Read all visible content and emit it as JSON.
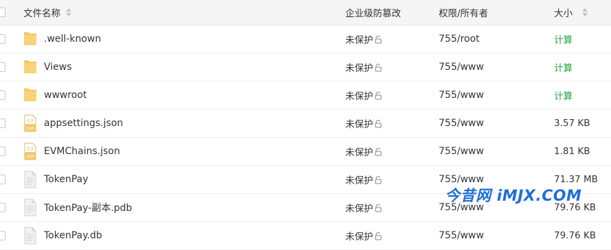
{
  "columns": {
    "name": "文件名称",
    "protection": "企业级防篡改",
    "permission": "权限/所有者",
    "size": "大小"
  },
  "rows": [
    {
      "name": ".well-known",
      "type": "folder",
      "protection": "未保护",
      "permission": "755/root",
      "size": "计算",
      "size_is_action": true
    },
    {
      "name": "Views",
      "type": "folder",
      "protection": "未保护",
      "permission": "755/www",
      "size": "计算",
      "size_is_action": true
    },
    {
      "name": "wwwroot",
      "type": "folder",
      "protection": "未保护",
      "permission": "755/www",
      "size": "计算",
      "size_is_action": true
    },
    {
      "name": "appsettings.json",
      "type": "json",
      "protection": "未保护",
      "permission": "755/www",
      "size": "3.57 KB",
      "size_is_action": false
    },
    {
      "name": "EVMChains.json",
      "type": "json",
      "protection": "未保护",
      "permission": "755/www",
      "size": "1.81 KB",
      "size_is_action": false
    },
    {
      "name": "TokenPay",
      "type": "file",
      "protection": "未保护",
      "permission": "755/www",
      "size": "71.37 MB",
      "size_is_action": false
    },
    {
      "name": "TokenPay-副本.pdb",
      "type": "file",
      "protection": "未保护",
      "permission": "755/www",
      "size": "79.76 KB",
      "size_is_action": false
    },
    {
      "name": "TokenPay.db",
      "type": "file",
      "protection": "未保护",
      "permission": "755/www",
      "size": "79.76 KB",
      "size_is_action": false
    }
  ],
  "watermark": "今昔网 iMJX.COM",
  "colors": {
    "calc_link": "#20a53a",
    "folder": "#f6c760",
    "watermark": "#1e6fd9"
  }
}
